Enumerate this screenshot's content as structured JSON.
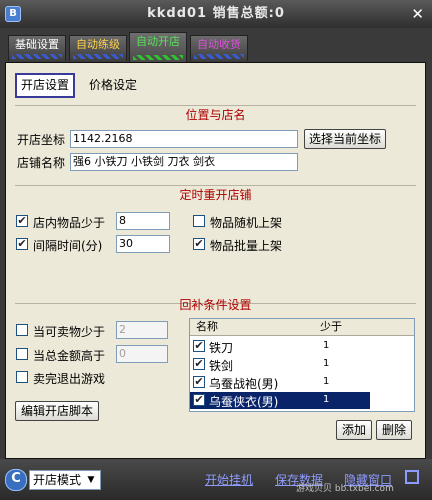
{
  "window": {
    "logo": "B",
    "title": "kkdd01   销售总额:0",
    "close": "✕"
  },
  "top_tabs": [
    {
      "label": "基础设置",
      "color": "#ffffff"
    },
    {
      "label": "自动练级",
      "color": "#ffd24a"
    },
    {
      "label": "自动开店",
      "color": "#5ce05c"
    },
    {
      "label": "自动收货",
      "color": "#e050e0"
    }
  ],
  "sub_tabs": [
    "开店设置",
    "价格设定"
  ],
  "location": {
    "section_title": "位置与店名",
    "coord_label": "开店坐标",
    "coord_value": "1142.2168",
    "select_coord_button": "选择当前坐标",
    "name_label": "店铺名称",
    "name_value": "强6 小铁刀 小铁剑 刀衣 剑衣"
  },
  "timer": {
    "section_title": "定时重开店铺",
    "items_below_label": "店内物品少于",
    "items_below_value": "8",
    "items_below_checked": "✔",
    "interval_label": "间隔时间(分)",
    "interval_value": "30",
    "interval_checked": "✔",
    "random_label": "物品随机上架",
    "random_checked": "",
    "batch_label": "物品批量上架",
    "batch_checked": "✔"
  },
  "restock": {
    "section_title": "回补条件设置",
    "sellable_label": "当可卖物少于",
    "sellable_value": "2",
    "money_label": "当总金额高于",
    "money_value": "0",
    "exit_label": "卖完退出游戏",
    "edit_script_button": "编辑开店脚本",
    "col_name": "名称",
    "col_qty": "少于",
    "rows": [
      {
        "name": "铁刀",
        "qty": "1",
        "check": "✔"
      },
      {
        "name": "铁剑",
        "qty": "1",
        "check": "✔"
      },
      {
        "name": "乌蚕战袍(男)",
        "qty": "1",
        "check": "✔"
      },
      {
        "name": "乌蚕侠衣(男)",
        "qty": "1",
        "check": "✔"
      }
    ],
    "add_button": "添加",
    "delete_button": "删除"
  },
  "bottom": {
    "icon": "C",
    "mode_value": "开店模式",
    "mode_arrow": "▼",
    "start_link": "开始挂机",
    "save_link": "保存数据",
    "hide_link": "隐藏窗口",
    "watermark": "游戏贝贝 bb.txbei.com"
  }
}
